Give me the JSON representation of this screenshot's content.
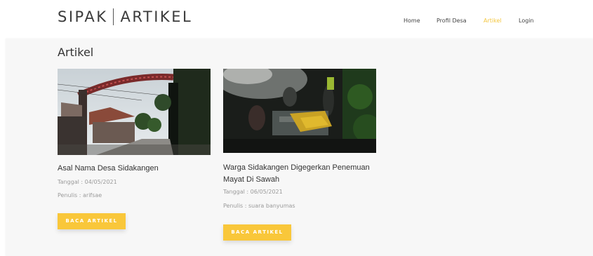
{
  "brand": {
    "left": "SIPAK",
    "right": "ARTIKEL"
  },
  "nav": {
    "items": [
      {
        "label": "Home"
      },
      {
        "label": "Profil Desa"
      },
      {
        "label": "Artikel",
        "active": true
      },
      {
        "label": "Login"
      }
    ]
  },
  "colors": {
    "accent": "#f9c73a",
    "nav_active": "#f3c63f"
  },
  "main": {
    "title": "Artikel",
    "articles": [
      {
        "title": "Asal Nama Desa Sidakangen",
        "date": "Tanggal : 04/05/2021",
        "author": "Penulis : arifsae",
        "button": "BACA ARTIKEL"
      },
      {
        "title": "Warga Sidakangen Digegerkan Penemuan Mayat Di Sawah",
        "date": "Tanggal : 06/05/2021",
        "author": "Penulis : suara banyumas",
        "button": "BACA ARTIKEL"
      }
    ]
  }
}
